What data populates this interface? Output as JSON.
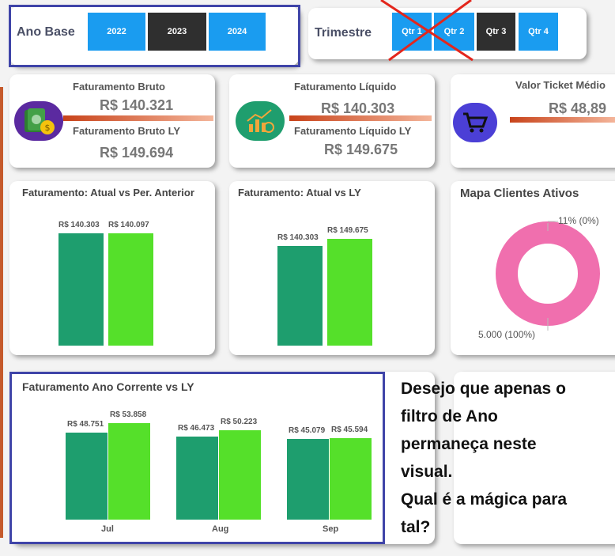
{
  "filters": {
    "year": {
      "label": "Ano Base",
      "options": [
        "2022",
        "2023",
        "2024"
      ],
      "selected": "2023"
    },
    "quarter": {
      "label": "Trimestre",
      "options": [
        "Qtr 1",
        "Qtr 2",
        "Qtr 3",
        "Qtr 4"
      ],
      "selected": "Qtr 3"
    }
  },
  "kpis": {
    "gross": {
      "title": "Faturamento Bruto",
      "value": "R$ 140.321",
      "ly_title": "Faturamento Bruto LY",
      "ly_value": "R$ 149.694",
      "icon": "money-bag-icon"
    },
    "net": {
      "title": "Faturamento Líquido",
      "value": "R$ 140.303",
      "ly_title": "Faturamento Líquido LY",
      "ly_value": "R$ 149.675",
      "icon": "growth-chart-icon"
    },
    "ticket": {
      "title": "Valor Ticket Médio",
      "value": "R$ 48,89",
      "icon": "shopping-cart-icon"
    }
  },
  "colors": {
    "current": "#1e9e6e",
    "compare": "#55e02a",
    "accent_blue": "#1a9cf0",
    "donut": "#f06fae",
    "frame": "#3f44a8"
  },
  "chart_data": [
    {
      "type": "bar",
      "title": "Faturamento: Atual vs Per. Anterior",
      "series": [
        {
          "values": [
            140303
          ],
          "labels": [
            "R$ 140.303"
          ]
        },
        {
          "values": [
            140097
          ],
          "labels": [
            "R$ 140.097"
          ]
        }
      ]
    },
    {
      "type": "bar",
      "title": "Faturamento: Atual vs LY",
      "series": [
        {
          "values": [
            140303
          ],
          "labels": [
            "R$ 140.303"
          ]
        },
        {
          "values": [
            149675
          ],
          "labels": [
            "R$ 149.675"
          ]
        }
      ]
    },
    {
      "type": "pie",
      "title": "Mapa Clientes Ativos",
      "slices": [
        {
          "value": 5000,
          "percent": 100,
          "label": "5.000 (100%)"
        },
        {
          "value": 11,
          "percent": 0,
          "label": "11% (0%)"
        }
      ]
    },
    {
      "type": "bar",
      "title": "Faturamento Ano Corrente vs LY",
      "categories": [
        "Jul",
        "Aug",
        "Sep"
      ],
      "series": [
        {
          "values": [
            48751,
            46473,
            45079
          ],
          "labels": [
            "R$ 48.751",
            "R$ 46.473",
            "R$ 45.079"
          ]
        },
        {
          "values": [
            53858,
            50223,
            45594
          ],
          "labels": [
            "R$ 53.858",
            "R$ 50.223",
            "R$ 45.594"
          ]
        }
      ]
    }
  ],
  "note": {
    "lines": [
      "Desejo que apenas o",
      "filtro de Ano",
      "permaneça neste",
      "visual.",
      "Qual é a mágica para",
      "tal?"
    ]
  }
}
